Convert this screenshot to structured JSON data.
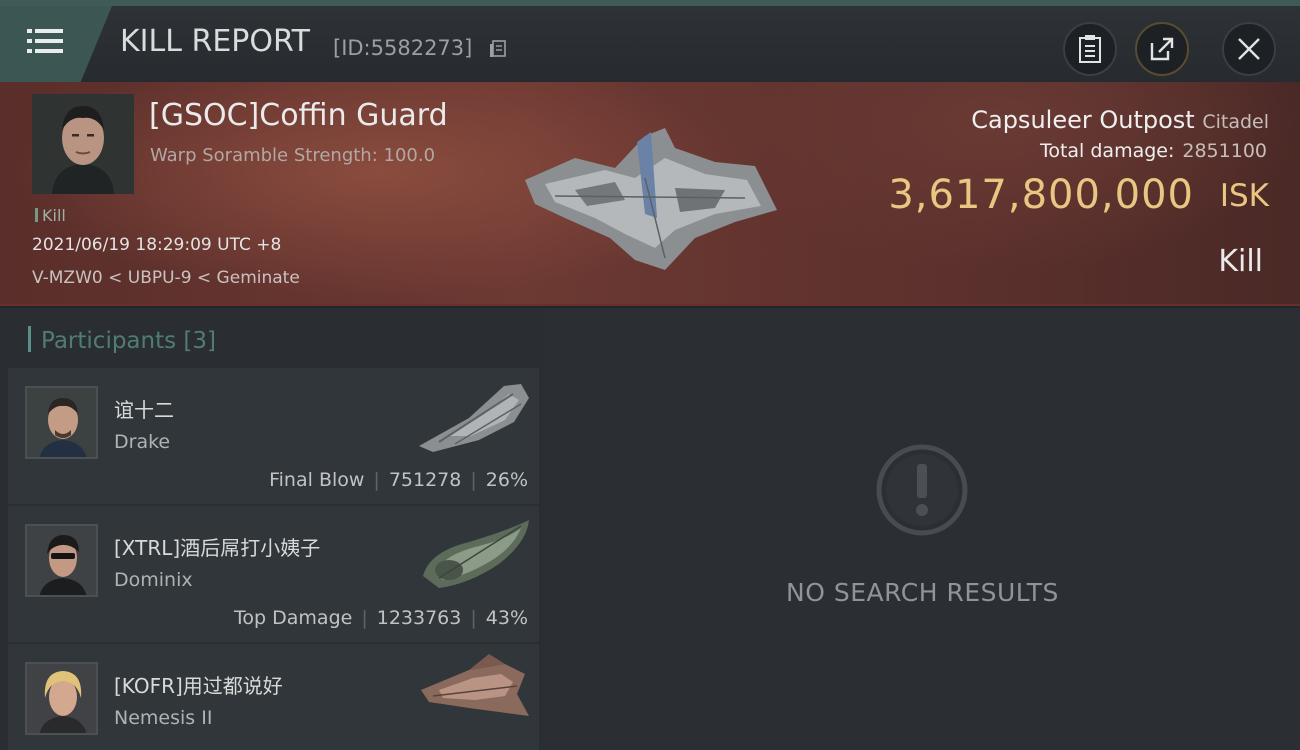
{
  "header": {
    "title": "KILL REPORT",
    "report_id": "[ID:5582273]",
    "buttons": [
      "clipboard-icon",
      "share-icon",
      "close-icon"
    ]
  },
  "victim": {
    "name": "[GSOC]Coffin Guard",
    "subtitle": "Warp Soramble Strength: 100.0",
    "tag": "Kill",
    "datetime": "2021/06/19 18:29:09 UTC +8",
    "location": "V-MZW0 < UBPU-9 < Geminate"
  },
  "target": {
    "name": "Capsuleer Outpost",
    "type": "Citadel",
    "total_damage_label": "Total damage:",
    "total_damage_value": "2851100",
    "isk_value": "3,617,800,000",
    "isk_unit": "ISK",
    "result": "Kill"
  },
  "participants": {
    "label": "Participants",
    "count": "[3]",
    "items": [
      {
        "name": "谊十二",
        "ship": "Drake",
        "role": "Final Blow",
        "damage": "751278",
        "percent": "26%"
      },
      {
        "name": "[XTRL]酒后屌打小姨子",
        "ship": "Dominix",
        "role": "Top Damage",
        "damage": "1233763",
        "percent": "43%"
      },
      {
        "name": "[KOFR]用过都说好",
        "ship": "Nemesis II",
        "role": "",
        "damage": "",
        "percent": ""
      }
    ]
  },
  "empty_state": {
    "message": "NO SEARCH RESULTS",
    "icon": "exclamation-icon"
  },
  "colors": {
    "accent_teal": "#3b5653",
    "isk_gold": "#e9c681",
    "hero_red": "#6d3933"
  }
}
